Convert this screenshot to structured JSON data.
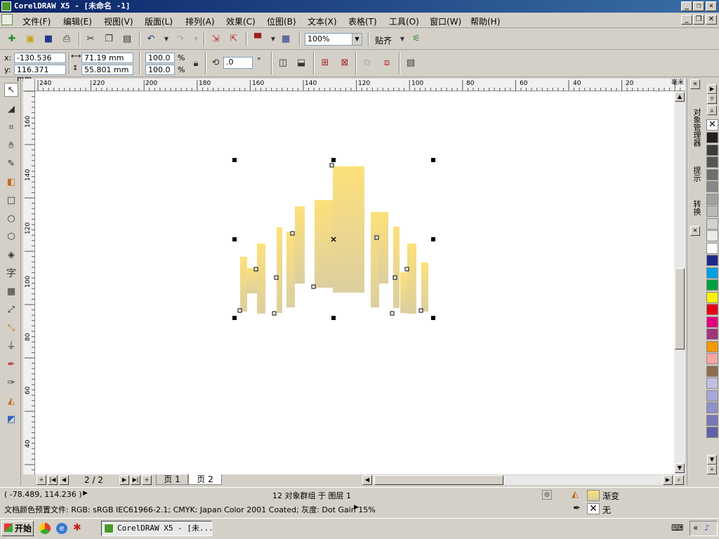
{
  "window": {
    "title": "CorelDRAW X5 - [未命名 -1]"
  },
  "menu": [
    "文件(F)",
    "编辑(E)",
    "视图(V)",
    "版面(L)",
    "排列(A)",
    "效果(C)",
    "位图(B)",
    "文本(X)",
    "表格(T)",
    "工具(O)",
    "窗口(W)",
    "帮助(H)"
  ],
  "toolbar": {
    "zoom_value": "100%",
    "snap_label": "贴齐"
  },
  "property_bar": {
    "x_label": "x:",
    "x_value": "-130.536 mm",
    "y_label": "y:",
    "y_value": "116.371 mm",
    "width_value": "71.19 mm",
    "height_value": "55.801 mm",
    "scale_w": "100.0",
    "scale_h": "100.0",
    "percent": "%",
    "rotation_value": ".0",
    "degree": "°"
  },
  "rulers": {
    "unit": "毫米",
    "h_ticks": [
      "240",
      "220",
      "200",
      "180",
      "160",
      "140",
      "120",
      "100",
      "80",
      "60",
      "40",
      "20"
    ],
    "v_ticks": [
      "160",
      "140",
      "120",
      "100",
      "80",
      "60",
      "40"
    ]
  },
  "pages": {
    "counter": "2 / 2",
    "tabs": [
      "页 1",
      "页 2"
    ],
    "active": "页 2"
  },
  "dockers": {
    "object_manager": "对象管理器",
    "hints": "提示",
    "transform": "转换"
  },
  "palette": [
    "#231f20",
    "#3c3c3c",
    "#555555",
    "#6e6e6e",
    "#878787",
    "#a0a0a0",
    "#b9b9b9",
    "#d2d2d2",
    "#ebebeb",
    "#ffffff",
    "#1e2a8a",
    "#00a0e6",
    "#00a040",
    "#fff200",
    "#e60012",
    "#e4007f",
    "#a0357a",
    "#f39800",
    "#f5a7a0",
    "#8c6e50",
    "#c0c0e0",
    "#a8a8d8",
    "#9090c8",
    "#7878b8",
    "#6060a8"
  ],
  "drawing": {
    "fill_color_top": "#fde07a",
    "fill_color_bottom": "#dccfa0"
  },
  "status": {
    "coords": "( -78.489, 114.236 )",
    "selection_info": "12 对象群组 于 图层 1",
    "fill_label": "渐变",
    "outline_label": "无",
    "color_profile": "文档颜色预置文件: RGB: sRGB IEC61966-2.1; CMYK: Japan Color 2001 Coated; 灰度: Dot Gain 15%"
  },
  "taskbar": {
    "start_label": "开始",
    "task_label": "CorelDRAW X5 - [未..."
  }
}
